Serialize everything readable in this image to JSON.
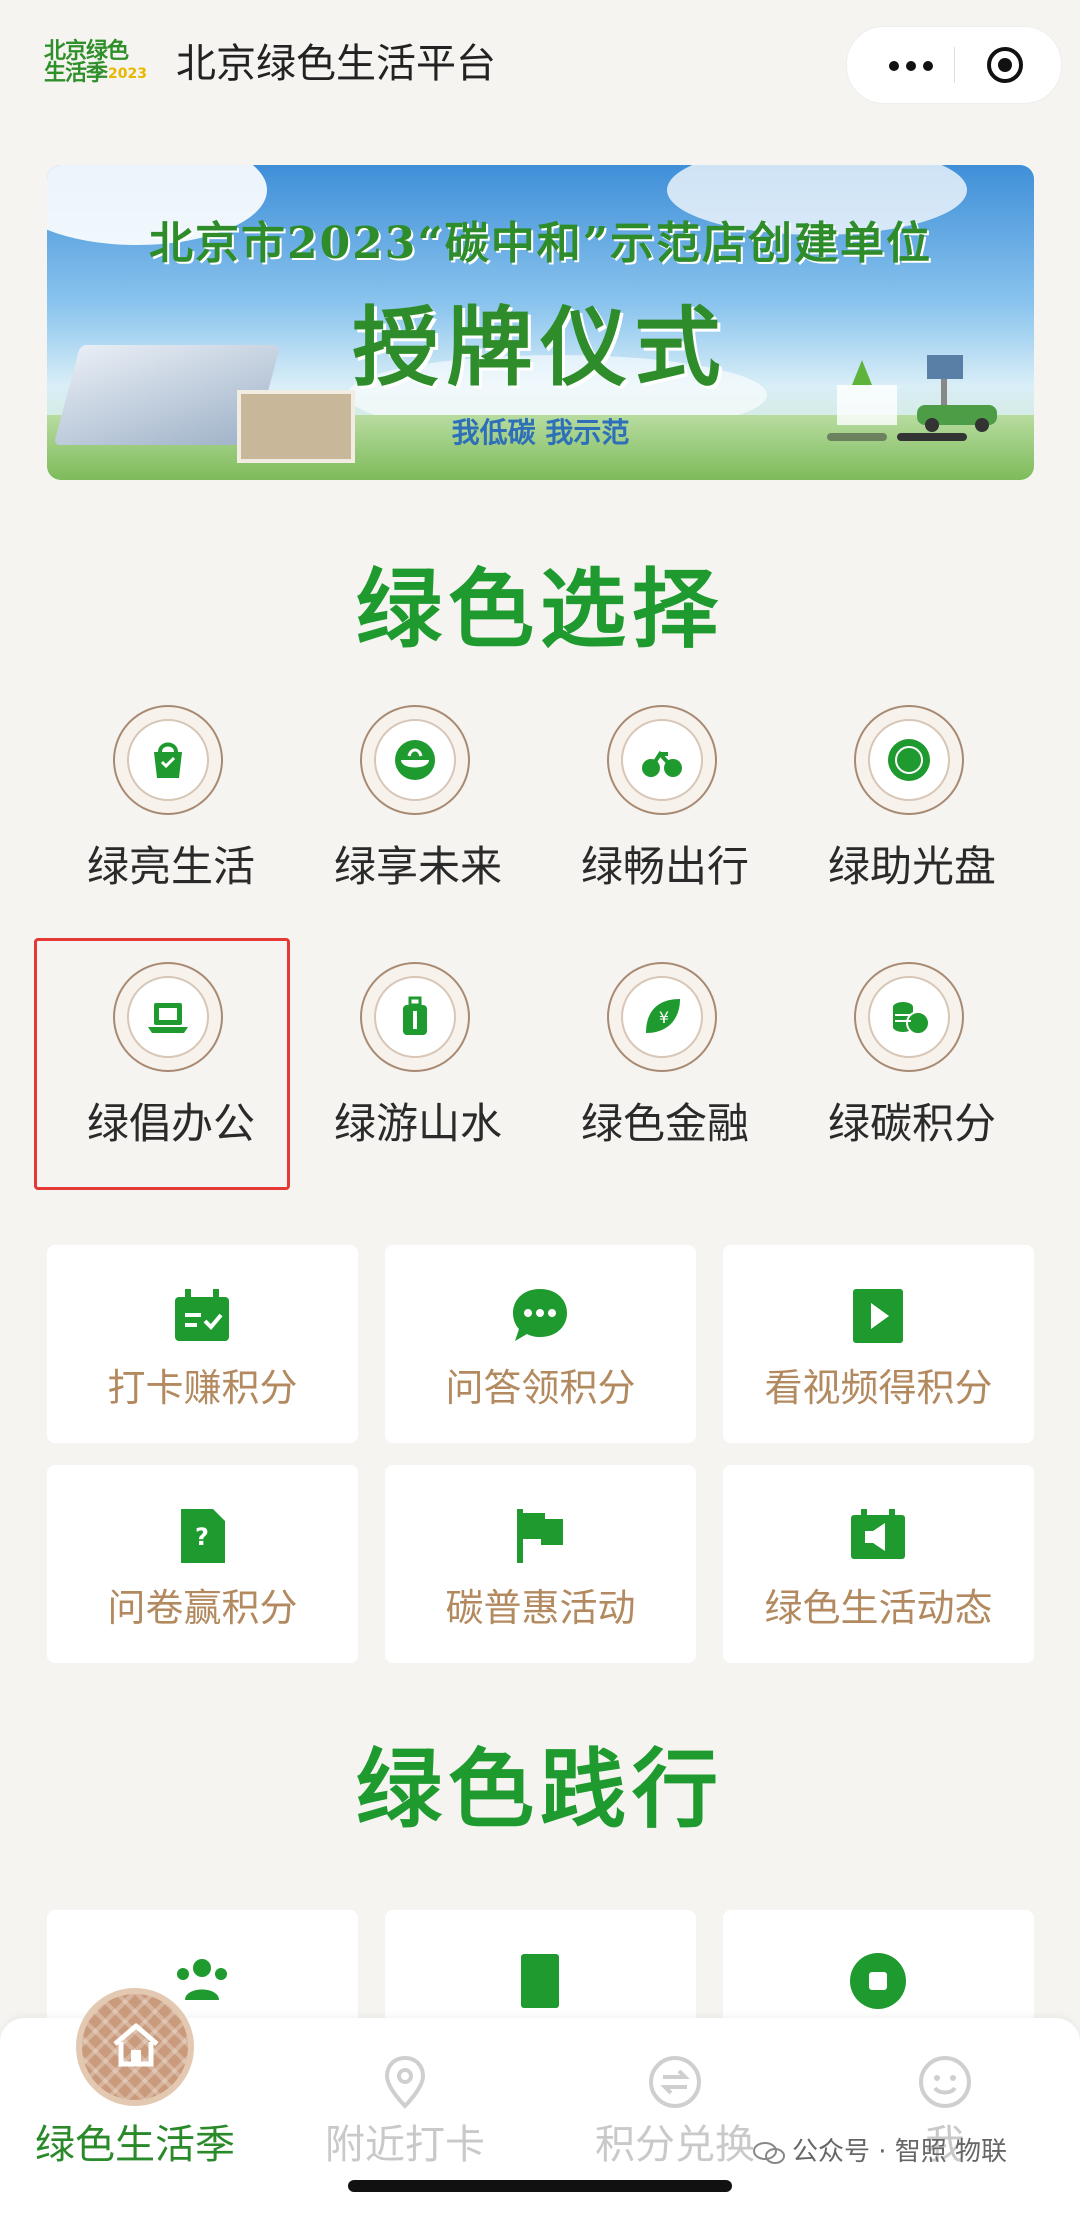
{
  "header": {
    "logo_line1": "北京绿色",
    "logo_line2": "生活季",
    "logo_year": "2023",
    "title": "北京绿色生活平台"
  },
  "banner": {
    "line1": "北京市2023“碳中和”示范店创建单位",
    "line2": "授牌仪式",
    "slogan": "我低碳 我示范"
  },
  "green_choice": {
    "title": "绿色选择",
    "items": [
      {
        "label": "绿亮生活",
        "icon": "shopping-bag-icon"
      },
      {
        "label": "绿享未来",
        "icon": "bowl-icon"
      },
      {
        "label": "绿畅出行",
        "icon": "bicycle-icon"
      },
      {
        "label": "绿助光盘",
        "icon": "plate-icon"
      },
      {
        "label": "绿倡办公",
        "icon": "laptop-icon"
      },
      {
        "label": "绿游山水",
        "icon": "suitcase-icon"
      },
      {
        "label": "绿色金融",
        "icon": "yuan-leaf-icon"
      },
      {
        "label": "绿碳积分",
        "icon": "coins-icon"
      }
    ]
  },
  "actions": [
    {
      "label": "打卡赚积分",
      "icon": "calendar-check-icon"
    },
    {
      "label": "问答领积分",
      "icon": "chat-bubble-icon"
    },
    {
      "label": "看视频得积分",
      "icon": "play-video-icon"
    },
    {
      "label": "问卷赢积分",
      "icon": "question-doc-icon"
    },
    {
      "label": "碳普惠活动",
      "icon": "flag-icon"
    },
    {
      "label": "绿色生活动态",
      "icon": "megaphone-icon"
    }
  ],
  "green_practice": {
    "title": "绿色践行",
    "items": [
      {
        "icon": "people-icon"
      },
      {
        "icon": "book-icon"
      },
      {
        "icon": "stop-circle-icon"
      }
    ]
  },
  "tabbar": {
    "tabs": [
      {
        "label": "绿色生活季",
        "icon": "home-icon",
        "active": true
      },
      {
        "label": "附近打卡",
        "icon": "location-pin-icon",
        "active": false
      },
      {
        "label": "积分兑换",
        "icon": "exchange-icon",
        "active": false
      },
      {
        "label": "我",
        "icon": "smile-icon",
        "active": false
      }
    ]
  },
  "watermark": "公众号 · 智照 物联",
  "colors": {
    "primary_green": "#1e9a2f",
    "card_label_brown": "#b38a5f",
    "highlight_red": "#e53935"
  }
}
